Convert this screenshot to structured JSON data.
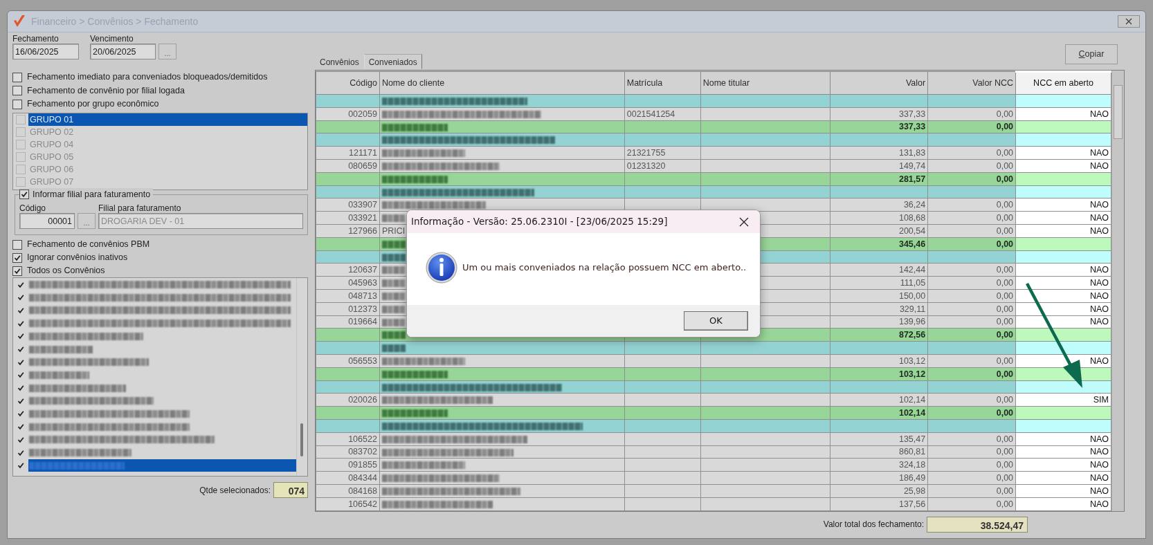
{
  "window": {
    "title": "Financeiro > Convênios > Fechamento"
  },
  "closing": {
    "label": "Fechamento",
    "value": "16/06/2025"
  },
  "due": {
    "label": "Vencimento",
    "value": "20/06/2025",
    "button": "..."
  },
  "options": [
    {
      "label": "Fechamento imediato para conveniados bloqueados/demitidos",
      "checked": false
    },
    {
      "label": "Fechamento de convênio por filial logada",
      "checked": false
    },
    {
      "label": "Fechamento por grupo econômico",
      "checked": false
    }
  ],
  "groups": [
    {
      "label": "GRUPO 01",
      "selected": true,
      "checked": false,
      "disabled": true
    },
    {
      "label": "GRUPO 02",
      "selected": false,
      "checked": false,
      "disabled": true
    },
    {
      "label": "GRUPO 04",
      "selected": false,
      "checked": false,
      "disabled": true
    },
    {
      "label": "GRUPO 05",
      "selected": false,
      "checked": false,
      "disabled": true
    },
    {
      "label": "GRUPO 06",
      "selected": false,
      "checked": false,
      "disabled": true
    },
    {
      "label": "GRUPO 07",
      "selected": false,
      "checked": false,
      "disabled": true
    }
  ],
  "branch": {
    "label": "Informar filial para faturamento",
    "checked": true,
    "code_label": "Código",
    "code": "00001",
    "button": "...",
    "name_label": "Filial para faturamento",
    "name": "DROGARIA DEV - 01"
  },
  "options2": [
    {
      "label": "Fechamento de convênios PBM",
      "checked": false
    },
    {
      "label": "Ignorar convênios inativos",
      "checked": true
    },
    {
      "label": "Todos os Convênios",
      "checked": true
    }
  ],
  "agreements": [
    {
      "checked": true,
      "selected": false
    },
    {
      "checked": true,
      "selected": false
    },
    {
      "checked": true,
      "selected": false
    },
    {
      "checked": true,
      "selected": false
    },
    {
      "checked": true,
      "selected": false
    },
    {
      "checked": true,
      "selected": false
    },
    {
      "checked": true,
      "selected": false
    },
    {
      "checked": true,
      "selected": false
    },
    {
      "checked": true,
      "selected": false
    },
    {
      "checked": true,
      "selected": false
    },
    {
      "checked": true,
      "selected": false
    },
    {
      "checked": true,
      "selected": false
    },
    {
      "checked": true,
      "selected": false
    },
    {
      "checked": true,
      "selected": false
    },
    {
      "checked": true,
      "selected": true
    }
  ],
  "selected_count": {
    "label": "Qtde selecionados:",
    "value": "074"
  },
  "tabs": [
    {
      "label": "Convênios",
      "selected": false
    },
    {
      "label": "Conveniados",
      "selected": true
    }
  ],
  "copy_button": "Copiar",
  "table": {
    "columns": [
      "Código",
      "Nome do cliente",
      "Matrícula",
      "Nome titular",
      "Valor",
      "Valor NCC",
      "NCC em aberto"
    ],
    "rows": [
      {
        "kind": "group"
      },
      {
        "kind": "item",
        "code": "002059",
        "registration": "0021541254",
        "value": "337,33",
        "ncc_value": "0,00",
        "ncc_open": "NAO"
      },
      {
        "kind": "total",
        "value": "337,33",
        "ncc_value": "0,00"
      },
      {
        "kind": "group"
      },
      {
        "kind": "item",
        "code": "121171",
        "registration": "21321755",
        "value": "131,83",
        "ncc_value": "0,00",
        "ncc_open": "NAO"
      },
      {
        "kind": "item",
        "code": "080659",
        "registration": "01231320",
        "value": "149,74",
        "ncc_value": "0,00",
        "ncc_open": "NAO"
      },
      {
        "kind": "total",
        "value": "281,57",
        "ncc_value": "0,00"
      },
      {
        "kind": "group"
      },
      {
        "kind": "item",
        "code": "033907",
        "value": "36,24",
        "ncc_value": "0,00",
        "ncc_open": "NAO"
      },
      {
        "kind": "item",
        "code": "033921",
        "value": "108,68",
        "ncc_value": "0,00",
        "ncc_open": "NAO"
      },
      {
        "kind": "item",
        "code": "127966",
        "name": "PRICI",
        "value": "200,54",
        "ncc_value": "0,00",
        "ncc_open": "NAO"
      },
      {
        "kind": "total",
        "value": "345,46",
        "ncc_value": "0,00"
      },
      {
        "kind": "group"
      },
      {
        "kind": "item",
        "code": "120637",
        "value": "142,44",
        "ncc_value": "0,00",
        "ncc_open": "NAO"
      },
      {
        "kind": "item",
        "code": "045963",
        "value": "111,05",
        "ncc_value": "0,00",
        "ncc_open": "NAO"
      },
      {
        "kind": "item",
        "code": "048713",
        "value": "150,00",
        "ncc_value": "0,00",
        "ncc_open": "NAO"
      },
      {
        "kind": "item",
        "code": "012373",
        "value": "329,11",
        "ncc_value": "0,00",
        "ncc_open": "NAO"
      },
      {
        "kind": "item",
        "code": "019664",
        "value": "139,96",
        "ncc_value": "0,00",
        "ncc_open": "NAO"
      },
      {
        "kind": "total",
        "value": "872,56",
        "ncc_value": "0,00"
      },
      {
        "kind": "group"
      },
      {
        "kind": "item",
        "code": "056553",
        "value": "103,12",
        "ncc_value": "0,00",
        "ncc_open": "NAO"
      },
      {
        "kind": "total",
        "value": "103,12",
        "ncc_value": "0,00"
      },
      {
        "kind": "group"
      },
      {
        "kind": "item",
        "code": "020026",
        "value": "102,14",
        "ncc_value": "0,00",
        "ncc_open": "SIM"
      },
      {
        "kind": "total",
        "value": "102,14",
        "ncc_value": "0,00"
      },
      {
        "kind": "group"
      },
      {
        "kind": "item",
        "code": "106522",
        "value": "135,47",
        "ncc_value": "0,00",
        "ncc_open": "NAO"
      },
      {
        "kind": "item",
        "code": "083702",
        "value": "860,81",
        "ncc_value": "0,00",
        "ncc_open": "NAO"
      },
      {
        "kind": "item",
        "code": "091855",
        "value": "324,18",
        "ncc_value": "0,00",
        "ncc_open": "NAO"
      },
      {
        "kind": "item",
        "code": "084344",
        "value": "186,49",
        "ncc_value": "0,00",
        "ncc_open": "NAO"
      },
      {
        "kind": "item",
        "code": "084168",
        "value": "25,98",
        "ncc_value": "0,00",
        "ncc_open": "NAO"
      },
      {
        "kind": "item",
        "code": "106542",
        "value": "137,56",
        "ncc_value": "0,00",
        "ncc_open": "NAO"
      }
    ]
  },
  "total": {
    "label": "Valor total dos fechamento:",
    "value": "38.524,47"
  },
  "dialog": {
    "title": "Informação - Versão: 25.06.2310I - [23/06/2025 15:29]",
    "message": "Um ou mais conveniados na relação possuem NCC em aberto..",
    "button": "OK"
  }
}
